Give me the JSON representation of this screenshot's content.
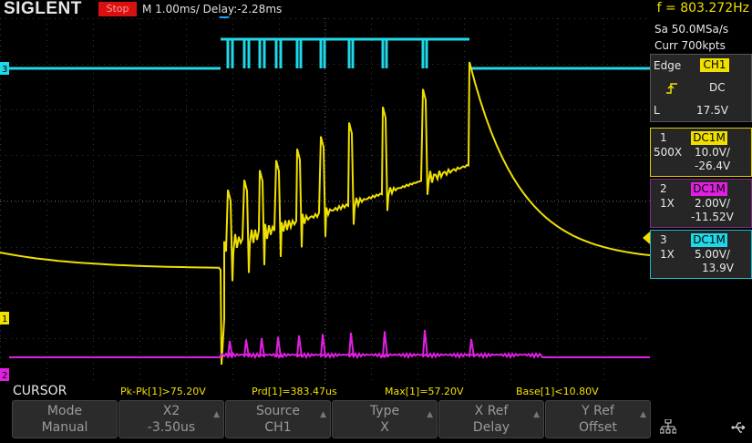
{
  "header": {
    "brand": "SIGLENT",
    "run_state": "Stop",
    "timebase": "M 1.00ms/ Delay:-2.28ms",
    "frequency": "f = 803.272Hz"
  },
  "acquisition": {
    "sample_rate": "Sa 50.0MSa/s",
    "memory": "Curr 700kpts"
  },
  "trigger": {
    "mode": "Edge",
    "source": "CH1",
    "slope_icon": "rising-edge-icon",
    "coupling": "DC",
    "level_label": "L",
    "level": "17.5V"
  },
  "channels": [
    {
      "num": "1",
      "coupling": "DC1M",
      "probe": "500X",
      "scale": "10.0V/",
      "offset": "-26.4V",
      "color": "#f0e000"
    },
    {
      "num": "2",
      "coupling": "DC1M",
      "probe": "1X",
      "scale": "2.00V/",
      "offset": "-11.52V",
      "color": "#e020e0"
    },
    {
      "num": "3",
      "coupling": "DC1M",
      "probe": "1X",
      "scale": "5.00V/",
      "offset": "13.9V",
      "color": "#20d8e8"
    }
  ],
  "markers": {
    "ch1": "1",
    "ch2": "2",
    "ch3": "3"
  },
  "cursor": {
    "title": "CURSOR",
    "measurements": [
      "Pk-Pk[1]>75.20V",
      "Prd[1]=383.47us",
      "Max[1]=57.20V",
      "Base[1]<10.80V"
    ]
  },
  "softkeys": [
    {
      "label": "Mode",
      "value": "Manual",
      "arrow": false
    },
    {
      "label": "X2",
      "value": "-3.50us",
      "arrow": true
    },
    {
      "label": "Source",
      "value": "CH1",
      "arrow": true
    },
    {
      "label": "Type",
      "value": "X",
      "arrow": true
    },
    {
      "label": "X Ref",
      "value": "Delay",
      "arrow": true
    },
    {
      "label": "Y Ref",
      "value": "Offset",
      "arrow": true
    }
  ],
  "status_icons": [
    "network-icon",
    "usb-icon"
  ]
}
